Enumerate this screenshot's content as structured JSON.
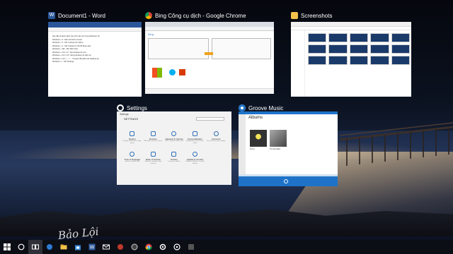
{
  "task_view": {
    "windows": [
      {
        "id": "word",
        "title": "Document1 - Word",
        "icon": "word-icon",
        "accent": "#2b579a"
      },
      {
        "id": "chrome",
        "title": "Bing Công cụ dịch - Google Chrome",
        "icon": "chrome-icon",
        "accent": "#db4437"
      },
      {
        "id": "explorer",
        "title": "Screenshots",
        "icon": "folder-icon",
        "accent": "#f2c24a"
      },
      {
        "id": "settings",
        "title": "Settings",
        "icon": "gear-icon",
        "accent": "#2f6fb6"
      },
      {
        "id": "groove",
        "title": "Groove Music",
        "icon": "groove-icon",
        "accent": "#1e73c8"
      }
    ]
  },
  "word_doc": {
    "lines": [
      "Sau đây là danh sách các phím tắt mới trong Windows 10:",
      "Windows + A : Hiển thị Action Center",
      "Windows + S : Mở Cortana (tìm kiếm)",
      "Windows + C : Mở Cortana ở chế độ lắng nghe",
      "Windows + Tab : Mở Task View",
      "Windows + Ctrl + D : Tạo desktop ảo mới",
      "Windows + Ctrl + F4 : Đóng desktop ảo hiện tại",
      "Windows + Ctrl + ←/→ : Chuyển đổi giữa các desktop ảo",
      "Windows + I : Mở Settings"
    ]
  },
  "chrome": {
    "brand": "Bing"
  },
  "settings": {
    "title": "Settings",
    "heading": "SETTINGS",
    "items": [
      {
        "label": "System",
        "sub": "Display, notifications, apps, power",
        "icon": "monitor-icon"
      },
      {
        "label": "Devices",
        "sub": "Bluetooth, printers, mouse",
        "icon": "keyboard-icon"
      },
      {
        "label": "Network & Internet",
        "sub": "Wi-Fi, airplane mode, VPN",
        "icon": "globe-icon"
      },
      {
        "label": "Personalization",
        "sub": "Background, lock screen, colors",
        "icon": "brush-icon"
      },
      {
        "label": "Accounts",
        "sub": "Your account, sync settings",
        "icon": "person-icon"
      },
      {
        "label": "Time & language",
        "sub": "Speech, region, date",
        "icon": "clock-icon"
      },
      {
        "label": "Ease of Access",
        "sub": "Narrator, magnifier, high contrast",
        "icon": "accessibility-icon"
      },
      {
        "label": "Privacy",
        "sub": "Location, camera",
        "icon": "lock-icon"
      },
      {
        "label": "Update & security",
        "sub": "Windows Update, recovery, backup",
        "icon": "refresh-icon"
      }
    ]
  },
  "groove": {
    "title": "Groove Music",
    "heading": "Albums",
    "albums": [
      {
        "name": "Kenny",
        "artist": "Kenny"
      },
      {
        "name": "The Revivalist",
        "artist": "The Revivalist"
      }
    ]
  },
  "taskbar": {
    "items": [
      {
        "name": "start-button",
        "icon": "windows-logo-icon"
      },
      {
        "name": "search-button",
        "icon": "search-icon"
      },
      {
        "name": "task-view-button",
        "icon": "task-view-icon"
      },
      {
        "name": "taskbar-edge",
        "icon": "edge-icon"
      },
      {
        "name": "taskbar-file-explorer",
        "icon": "folder-icon"
      },
      {
        "name": "taskbar-store",
        "icon": "store-icon"
      },
      {
        "name": "taskbar-word",
        "icon": "word-icon"
      },
      {
        "name": "taskbar-mail",
        "icon": "mail-icon"
      },
      {
        "name": "taskbar-app-a",
        "icon": "app-icon"
      },
      {
        "name": "taskbar-app-b",
        "icon": "app-icon"
      },
      {
        "name": "taskbar-chrome",
        "icon": "chrome-icon"
      },
      {
        "name": "taskbar-settings",
        "icon": "gear-icon"
      },
      {
        "name": "taskbar-groove",
        "icon": "groove-icon"
      },
      {
        "name": "taskbar-app-c",
        "icon": "app-icon"
      }
    ]
  }
}
